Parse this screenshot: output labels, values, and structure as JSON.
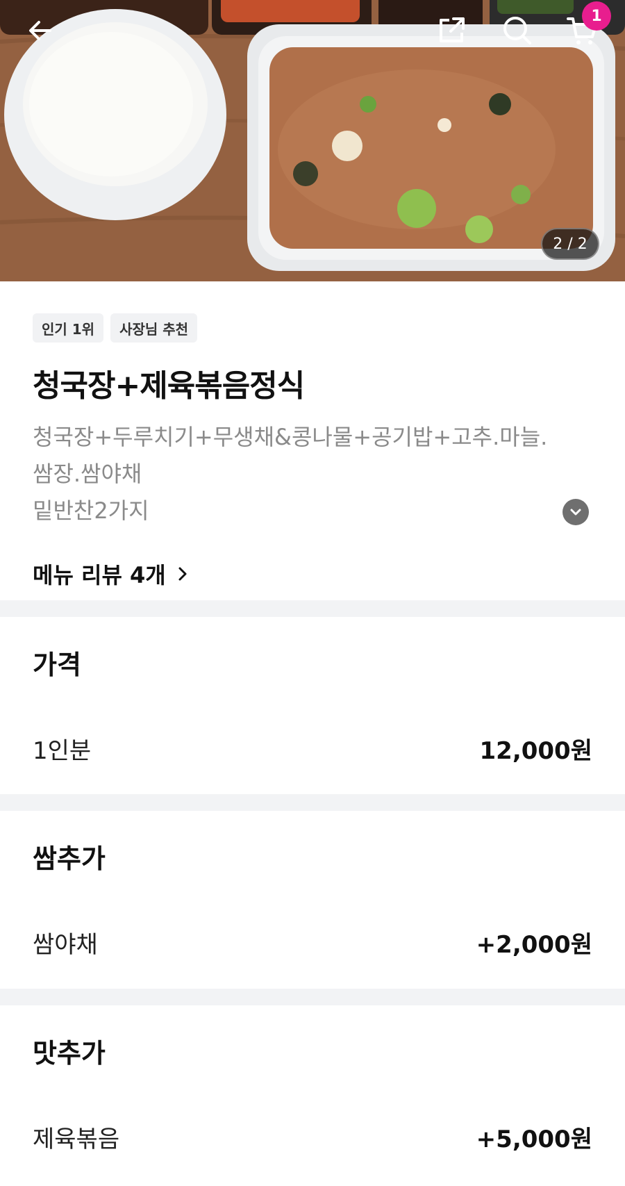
{
  "hero": {
    "image_counter": "2 / 2",
    "cart_count": "1",
    "icons": [
      "back-arrow-icon",
      "share-icon",
      "search-icon",
      "cart-icon"
    ],
    "badge_color": "#e81e8e"
  },
  "menu": {
    "tags": [
      "인기 1위",
      "사장님 추천"
    ],
    "title": "청국장+제육볶음정식",
    "description_lines": [
      "청국장+두루치기+무생채&콩나물+공기밥+고추.마늘.",
      "쌈장.쌈야채",
      "밑반찬2가지"
    ],
    "review_link": "메뉴 리뷰 4개"
  },
  "price_section": {
    "title": "가격",
    "option_label": "1인분",
    "option_price": "12,000원"
  },
  "ssam_section": {
    "title": "쌈추가",
    "option_label": "쌈야채",
    "option_price": "+2,000원"
  },
  "taste_section": {
    "title": "맛추가",
    "option_label": "제육볶음",
    "option_price": "+5,000원"
  }
}
